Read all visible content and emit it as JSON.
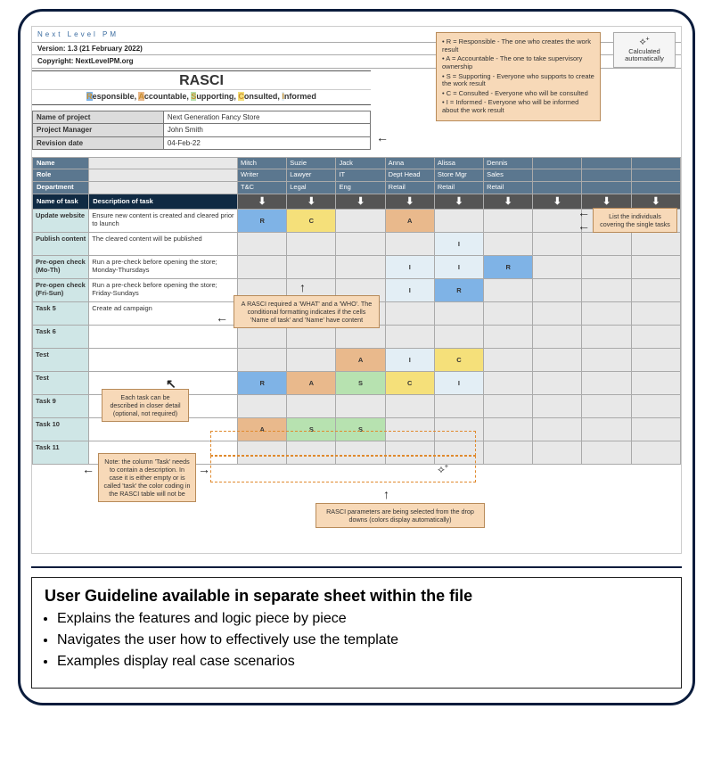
{
  "brand": "Next Level PM",
  "version_line": "Version: 1.3 (21 February 2022)",
  "copyright_line": "Copyright: NextLevelPM.org",
  "title": "RASCI",
  "subtitle_parts": [
    "R",
    "esponsible, ",
    "A",
    "ccountable, ",
    "S",
    "upporting, ",
    "C",
    "onsulted, ",
    "I",
    "nformed"
  ],
  "info": {
    "project_label": "Name of project",
    "project": "Next Generation Fancy Store",
    "pm_label": "Project Manager",
    "pm": "John Smith",
    "rev_label": "Revision date",
    "rev": "04-Feb-22"
  },
  "legend": [
    "• R = Responsible - The one who creates the work result",
    "• A = Accountable - The one to take supervisory ownership",
    "• S = Supporting - Everyone who supports to create the work result",
    "• C = Consulted - Everyone who will be consulted",
    "• I = Informed - Everyone who will be informed about the work result"
  ],
  "calc_auto": "Calculated automatically",
  "headers": {
    "name": "Name",
    "role": "Role",
    "dept": "Department",
    "taskname": "Name of task",
    "taskdesc": "Description of task"
  },
  "people": [
    {
      "name": "Mitch",
      "role": "Writer",
      "dept": "T&C"
    },
    {
      "name": "Suzie",
      "role": "Lawyer",
      "dept": "Legal"
    },
    {
      "name": "Jack",
      "role": "IT",
      "dept": "Eng"
    },
    {
      "name": "Anna",
      "role": "Dept Head",
      "dept": "Retail"
    },
    {
      "name": "Alissa",
      "role": "Store Mgr",
      "dept": "Retail"
    },
    {
      "name": "Dennis",
      "role": "Sales",
      "dept": "Retail"
    }
  ],
  "tasks": [
    {
      "name": "Update website",
      "desc": "Ensure new content is created and cleared prior to launch",
      "vals": [
        "R",
        "C",
        "",
        "A",
        "",
        "",
        "",
        "",
        ""
      ]
    },
    {
      "name": "Publish content",
      "desc": "The cleared content will be published",
      "vals": [
        "",
        "",
        "",
        "",
        "I",
        "",
        "",
        "",
        ""
      ]
    },
    {
      "name": "Pre-open check (Mo-Th)",
      "desc": "Run a pre-check before opening the store; Monday-Thursdays",
      "vals": [
        "",
        "",
        "",
        "I",
        "I",
        "R",
        "",
        "",
        ""
      ]
    },
    {
      "name": "Pre-open check (Fri-Sun)",
      "desc": "Run a pre-check before opening the store; Friday-Sundays",
      "vals": [
        "",
        "",
        "",
        "I",
        "R",
        "",
        "",
        "",
        ""
      ]
    },
    {
      "name": "Task 5",
      "desc": "Create ad campaign",
      "vals": [
        "",
        "",
        "",
        "",
        "",
        "",
        "",
        "",
        ""
      ]
    },
    {
      "name": "Task 6",
      "desc": "",
      "vals": [
        "",
        "",
        "",
        "",
        "",
        "",
        "",
        "",
        ""
      ]
    },
    {
      "name": "Test",
      "desc": "",
      "vals": [
        "",
        "",
        "A",
        "I",
        "C",
        "",
        "",
        "",
        ""
      ]
    },
    {
      "name": "Test",
      "desc": "",
      "vals": [
        "R",
        "A",
        "S",
        "C",
        "I",
        "",
        "",
        "",
        ""
      ]
    },
    {
      "name": "Task 9",
      "desc": "",
      "vals": [
        "",
        "",
        "",
        "",
        "",
        "",
        "",
        "",
        ""
      ]
    },
    {
      "name": "Task 10",
      "desc": "",
      "vals": [
        "A",
        "S",
        "S",
        "",
        "",
        "",
        "",
        "",
        ""
      ]
    },
    {
      "name": "Task 11",
      "desc": "",
      "vals": [
        "",
        "",
        "",
        "",
        "",
        "",
        "",
        "",
        ""
      ]
    }
  ],
  "notes": {
    "list_individuals": "List the individuals covering the single tasks",
    "what_who": "A RASCI required a 'WHAT' and a 'WHO'. The conditional formatting indicates if the cells 'Name of task' and 'Name' have content",
    "task_detail": "Each task can be described in closer detail (optional, not required)",
    "task_column": "Note: the column 'Task' needs to contain a description. In case it is either empty or is called 'task' the color coding in the RASCI table will not be",
    "dropdowns": "RASCI parameters are being selected from the drop downs (colors display automatically)"
  },
  "guideline": {
    "title": "User Guideline available in separate sheet within the file",
    "bullets": [
      "Explains the features and logic piece by piece",
      "Navigates the user how to effectively use the template",
      "Examples display real case scenarios"
    ]
  }
}
